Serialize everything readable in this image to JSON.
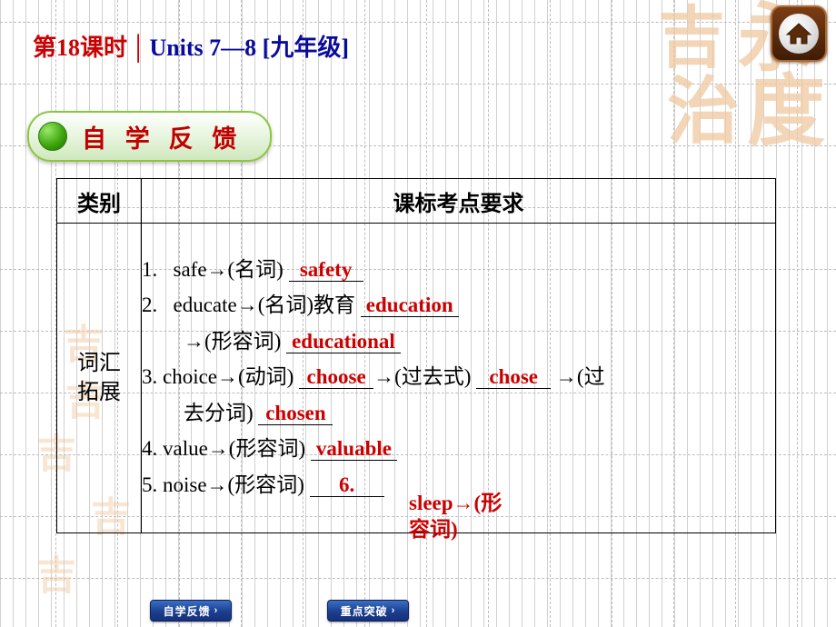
{
  "header": {
    "lesson": "第18课时",
    "separator": "│",
    "units": "Units 7—8 [九年级]"
  },
  "home_button": {
    "icon": "home-icon"
  },
  "section": {
    "title": "自 学 反 馈",
    "dot_icon": "green-bullet-icon"
  },
  "table": {
    "headers": [
      "类别",
      "课标考点要求"
    ],
    "row_category": "词汇\n拓展",
    "items": [
      {
        "num": "1.",
        "prompt": "safe→(名词)",
        "answer": "safety"
      },
      {
        "num": "2.",
        "prompt": "educate→(名词)教育",
        "answer": "education",
        "sub_prompt": "→(形容词)",
        "sub_answer": "educational"
      },
      {
        "num": "3.",
        "prompt": "choice→(动词)",
        "answer": "choose",
        "prompt2": "→(过去式)",
        "answer2": "chose",
        "prompt3": "→(过去分词)",
        "answer3": "chosen"
      },
      {
        "num": "4.",
        "prompt": "value→(形容词)",
        "answer": "valuable"
      },
      {
        "num": "5.",
        "prompt": "noise→(形容词)",
        "answer": "6."
      }
    ],
    "overflow_text": "sleep→(形容词)"
  },
  "footer": {
    "buttons": [
      {
        "label": "自学反馈",
        "chevron": "›"
      },
      {
        "label": "重点突破",
        "chevron": "›"
      }
    ]
  },
  "decor": {
    "seal_chars": [
      "吉",
      "永",
      "治",
      "度"
    ],
    "watermark_char": "吉"
  },
  "colors": {
    "title_red": "#cc0000",
    "title_blue": "#0a0a9c",
    "answer_red": "#cc0000",
    "pill_border": "#8cc63f",
    "footer_blue": "#1b3f8f",
    "seal_peach": "#f0c9a0"
  }
}
